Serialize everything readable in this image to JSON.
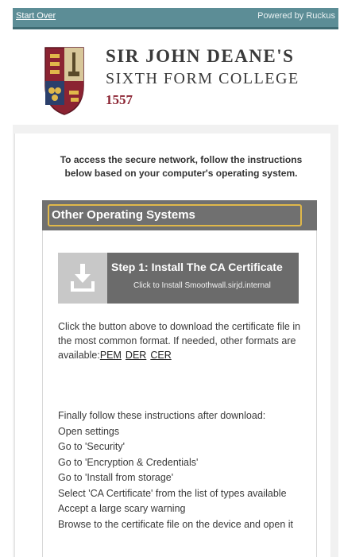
{
  "topbar": {
    "start_over": "Start Over",
    "powered_by": "Powered by Ruckus"
  },
  "college": {
    "line1": "SIR JOHN DEANE'S",
    "line2": "SIXTH FORM COLLEGE",
    "year": "1557",
    "crest_icon": "college-crest-icon"
  },
  "intro_text": "To access the secure network, follow the instructions below based on your computer's operating system.",
  "panel": {
    "title": "Other Operating Systems"
  },
  "install": {
    "title": "Step 1: Install The CA Certificate",
    "subtitle": "Click to Install Smoothwall.sirjd.internal",
    "icon": "download-icon"
  },
  "download_text": "Click the button above to download the certificate file in the most common format. If needed, other formats are available:",
  "formats": [
    "PEM",
    "DER",
    "CER"
  ],
  "instructions_intro": "Finally follow these instructions after download:",
  "instructions": [
    "Open settings",
    "Go to 'Security'",
    "Go to 'Encryption & Credentials'",
    "Go to 'Install from storage'",
    "Select 'CA Certificate' from the list of types available",
    "Accept a large scary warning",
    "Browse to the certificate file on the device and open it"
  ],
  "colors": {
    "topbar": "#5c8d96",
    "panel_header": "#707070",
    "panel_border_accent": "#e0b84a",
    "college_year": "#8b2332"
  }
}
